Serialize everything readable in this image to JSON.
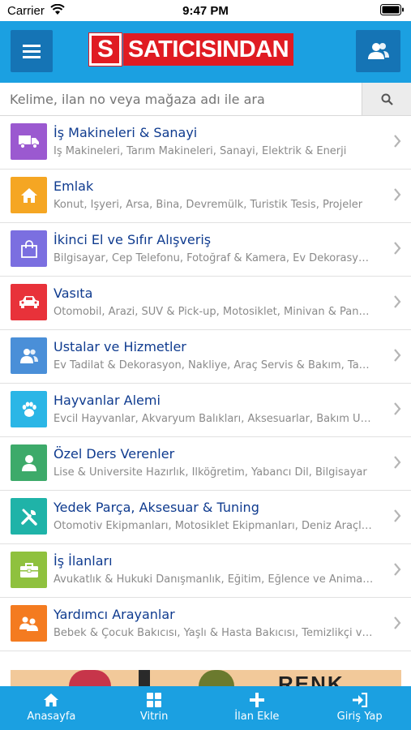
{
  "status_bar": {
    "carrier": "Carrier",
    "time": "9:47 PM"
  },
  "header": {
    "logo_mark": "S",
    "logo_text": "SATICISINDAN"
  },
  "search": {
    "placeholder": "Kelime, ilan no veya mağaza adı ile ara"
  },
  "categories": [
    {
      "title": "İş Makineleri & Sanayi",
      "subtitle": "İş Makineleri, Tarım Makineleri, Sanayi, Elektrik & Enerji",
      "icon": "truck-icon",
      "color": "#9b59d0"
    },
    {
      "title": "Emlak",
      "subtitle": "Konut, İşyeri, Arsa, Bina, Devremülk, Turistik Tesis, Projeler",
      "icon": "home-icon",
      "color": "#f5a623"
    },
    {
      "title": "İkinci El ve Sıfır Alışveriş",
      "subtitle": "Bilgisayar, Cep Telefonu, Fotoğraf & Kamera, Ev Dekorasyon, Ev Elektroniği",
      "icon": "shopping-bag-icon",
      "color": "#7b6fe0"
    },
    {
      "title": "Vasıta",
      "subtitle": "Otomobil, Arazi, SUV & Pick-up, Motosiklet, Minivan & Panelvan",
      "icon": "car-icon",
      "color": "#e8323a"
    },
    {
      "title": "Ustalar ve Hizmetler",
      "subtitle": "Ev Tadilat & Dekorasyon, Nakliye, Araç Servis & Bakım, Tamir",
      "icon": "users-icon",
      "color": "#4a8fd8"
    },
    {
      "title": "Hayvanlar Alemi",
      "subtitle": "Evcil Hayvanlar, Akvaryum Balıkları, Aksesuarlar, Bakım Ürünleri",
      "icon": "paw-icon",
      "color": "#2bb6e6"
    },
    {
      "title": "Özel Ders Verenler",
      "subtitle": "Lise & Üniversite Hazırlık, İlköğretim, Yabancı Dil, Bilgisayar",
      "icon": "person-icon",
      "color": "#3daa6a"
    },
    {
      "title": "Yedek Parça, Aksesuar & Tuning",
      "subtitle": "Otomotiv Ekipmanları, Motosiklet Ekipmanları, Deniz Araçları",
      "icon": "tools-icon",
      "color": "#1fb3a8"
    },
    {
      "title": "İş İlanları",
      "subtitle": "Avukatlık & Hukuki Danışmanlık, Eğitim, Eğlence ve Animasyon",
      "icon": "briefcase-icon",
      "color": "#8fc13e"
    },
    {
      "title": "Yardımcı Arayanlar",
      "subtitle": "Bebek & Çocuk Bakıcısı, Yaşlı & Hasta Bakıcısı, Temizlikçi ve Ev İşlerine Yardımcı",
      "icon": "helpers-icon",
      "color": "#f47b20"
    }
  ],
  "banner": {
    "text": "RENK"
  },
  "tabs": [
    {
      "label": "Anasayfa",
      "icon": "home-icon"
    },
    {
      "label": "Vitrin",
      "icon": "grid-icon"
    },
    {
      "label": "İlan Ekle",
      "icon": "plus-icon"
    },
    {
      "label": "Giriş Yap",
      "icon": "sign-in-icon"
    }
  ]
}
